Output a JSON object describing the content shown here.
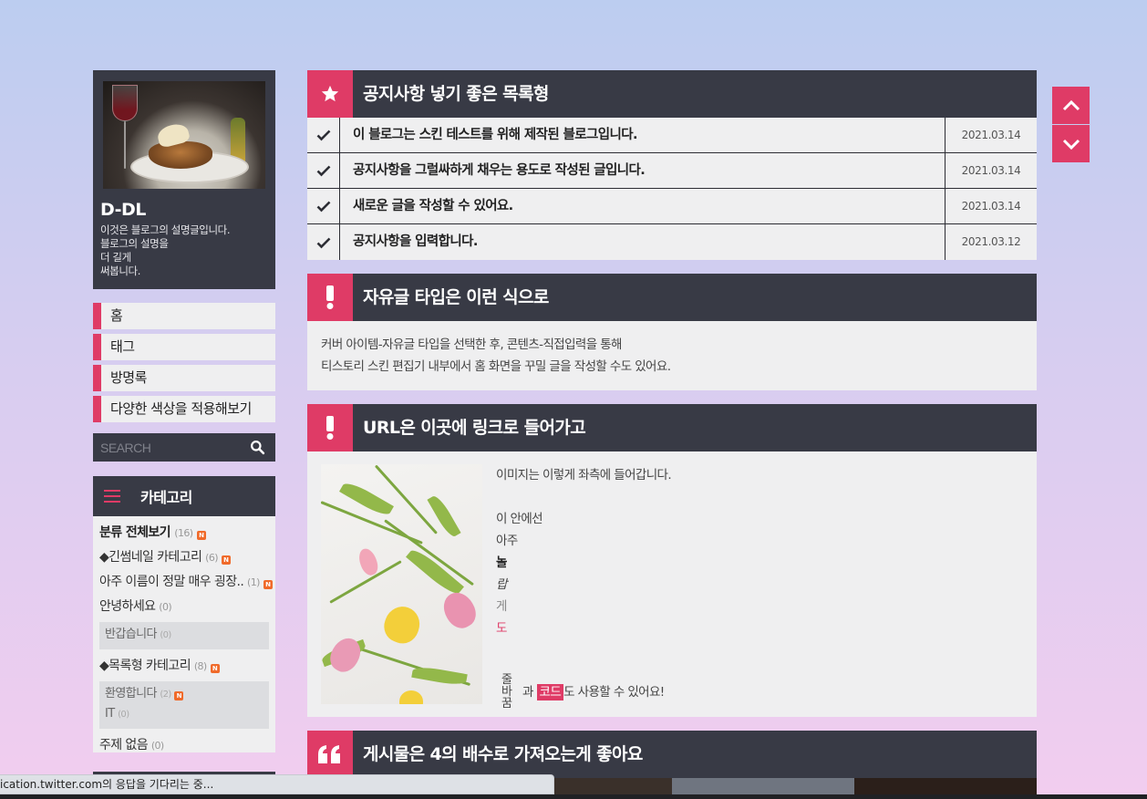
{
  "blog": {
    "title": "D-DL",
    "description": "이것은 블로그의 설명글입니다.\n블로그의 설명을\n더 길게\n써봅니다."
  },
  "nav": {
    "items": [
      "홈",
      "태그",
      "방명록",
      "다양한 색상을 적용해보기"
    ]
  },
  "search": {
    "placeholder": "SEARCH",
    "icon": "search-icon"
  },
  "category": {
    "title": "카테고리",
    "icon": "hamburger-icon",
    "new_badge": "N",
    "all": {
      "label": "분류 전체보기",
      "count": "(16)"
    },
    "items": [
      {
        "label": "◆긴썸네일 카테고리",
        "count": "(6)"
      },
      {
        "label": "아주 이름이 정말 매우 굉장..",
        "count": "(1)"
      },
      {
        "label": "안녕하세요",
        "count": "(0)"
      }
    ],
    "sub1": [
      {
        "label": "반갑습니다",
        "count": "(0)"
      }
    ],
    "list_type": {
      "label": "◆목록형 카테고리",
      "count": "(8)"
    },
    "sub2": [
      {
        "label": "환영합니다",
        "count": "(2)"
      },
      {
        "label": "IT",
        "count": "(0)"
      }
    ],
    "no_topic": {
      "label": "주제 없음",
      "count": "(0)"
    }
  },
  "notice": {
    "title": "공지사항 넣기 좋은 목록형",
    "icon": "star-icon",
    "rows": [
      {
        "title": "이 블로그는 스킨 테스트를 위해 제작된 블로그입니다.",
        "date": "2021.03.14"
      },
      {
        "title": "공지사항을 그럴싸하게 채우는 용도로 작성된 글입니다.",
        "date": "2021.03.14"
      },
      {
        "title": "새로운 글을 작성할 수 있어요.",
        "date": "2021.03.14"
      },
      {
        "title": "공지사항을 입력합니다.",
        "date": "2021.03.12"
      }
    ]
  },
  "free": {
    "title": "자유글 타입은 이런 식으로",
    "icon": "exclamation-icon",
    "line1": "커버 아이템-자유글 타입을 선택한 후, 콘텐츠-직접입력을 통해",
    "line2": "티스토리 스킨 편집기 내부에서 홈 화면을 꾸밀 글을 작성할 수도 있어요."
  },
  "url": {
    "title": "URL은 이곳에 링크로 들어가고",
    "icon": "exclamation-icon",
    "line1": "이미지는 이렇게 좌측에 들어갑니다.",
    "line2": "이 안에선",
    "line3": "아주",
    "line4": "놀",
    "line5": "랍",
    "line6": "게",
    "line7": "도",
    "vertical": [
      "줄",
      "바",
      "꿈"
    ],
    "code_prefix": "과 ",
    "code": "코드",
    "code_suffix": "도 사용할 수 있어요!"
  },
  "gallery": {
    "title": "게시물은 4의 배수로 가져오는게 좋아요",
    "icon": "quote-icon"
  },
  "scroll": {
    "up_icon": "chevron-up-icon",
    "down_icon": "chevron-down-icon"
  },
  "status": {
    "text": "ication.twitter.com의 응답을 기다리는 중..."
  },
  "colors": {
    "accent": "#df3b66",
    "dark": "#383a45",
    "panel": "#efeff0"
  }
}
